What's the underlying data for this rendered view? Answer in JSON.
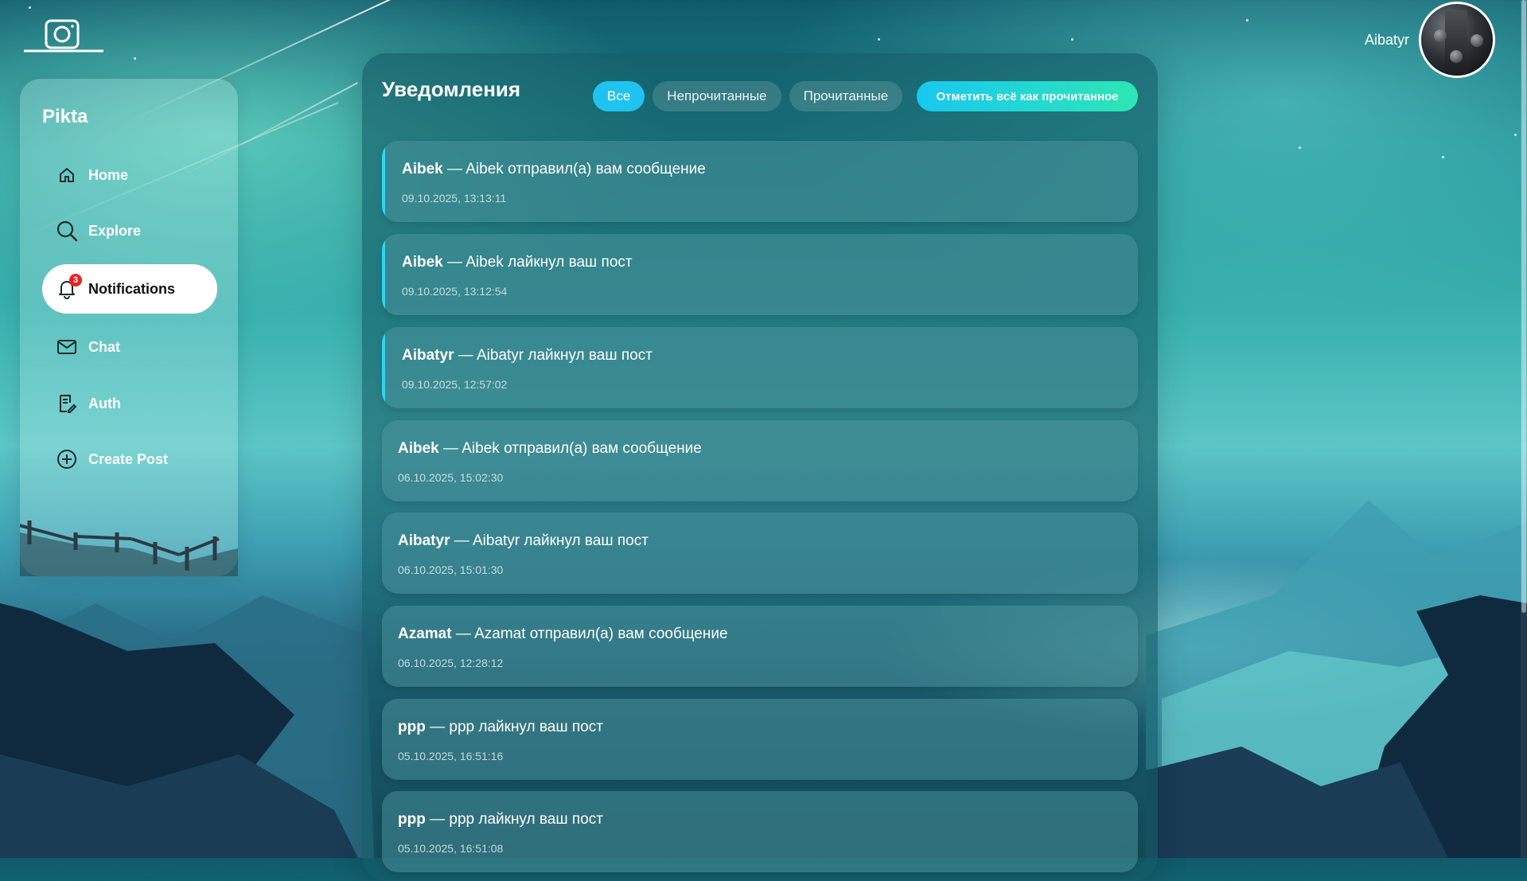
{
  "app": {
    "brand": "Pikta"
  },
  "sidebar": {
    "items": [
      {
        "label": "Home",
        "icon": "home-icon"
      },
      {
        "label": "Explore",
        "icon": "search-icon"
      },
      {
        "label": "Notifications",
        "icon": "bell-icon",
        "badge": "3",
        "active": true
      },
      {
        "label": "Chat",
        "icon": "mail-icon"
      },
      {
        "label": "Auth",
        "icon": "document-edit-icon"
      },
      {
        "label": "Create Post",
        "icon": "plus-circle-icon"
      }
    ]
  },
  "user": {
    "name": "Aibatyr"
  },
  "notifications": {
    "title": "Уведомления",
    "filters": [
      "Все",
      "Непрочитанные",
      "Прочитанные"
    ],
    "active_filter": "Все",
    "mark_all_label": "Отметить всё как прочитанное",
    "items": [
      {
        "author": "Aibek",
        "text": " — Aibek отправил(а) вам сообщение",
        "time": "09.10.2025, 13:13:11",
        "unread": true
      },
      {
        "author": "Aibek",
        "text": " — Aibek лайкнул ваш пост",
        "time": "09.10.2025, 13:12:54",
        "unread": true
      },
      {
        "author": "Aibatyr",
        "text": " — Aibatyr лайкнул ваш пост",
        "time": "09.10.2025, 12:57:02",
        "unread": true
      },
      {
        "author": "Aibek",
        "text": " — Aibek отправил(а) вам сообщение",
        "time": "06.10.2025, 15:02:30",
        "unread": false
      },
      {
        "author": "Aibatyr",
        "text": " — Aibatyr лайкнул ваш пост",
        "time": "06.10.2025, 15:01:30",
        "unread": false
      },
      {
        "author": "Azamat",
        "text": " — Azamat отправил(а) вам сообщение",
        "time": "06.10.2025, 12:28:12",
        "unread": false
      },
      {
        "author": "ppp",
        "text": " — ppp лайкнул ваш пост",
        "time": "05.10.2025, 16:51:16",
        "unread": false
      },
      {
        "author": "ppp",
        "text": " — ppp лайкнул ваш пост",
        "time": "05.10.2025, 16:51:08",
        "unread": false
      }
    ]
  },
  "colors": {
    "accent": "#20c3f0",
    "badge": "#e22222",
    "unread_bar": "#2fd4f0"
  }
}
